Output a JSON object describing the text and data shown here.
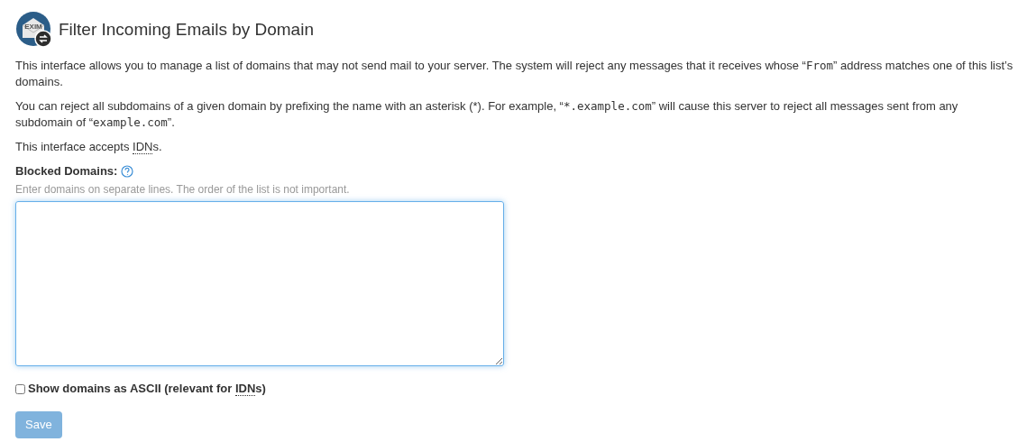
{
  "header": {
    "logo_text": "EXIM",
    "title": "Filter Incoming Emails by Domain"
  },
  "paragraphs": [
    [
      {
        "kind": "text",
        "text": "This interface allows you to manage a list of domains that may not send mail to your server. The system will reject any messages that it receives whose “"
      },
      {
        "kind": "code",
        "text": "From"
      },
      {
        "kind": "text",
        "text": "” address matches one of this list’s domains."
      }
    ],
    [
      {
        "kind": "text",
        "text": "You can reject all subdomains of a given domain by prefixing the name with an asterisk (*). For example, “"
      },
      {
        "kind": "code",
        "text": "*.example.com"
      },
      {
        "kind": "text",
        "text": "” will cause this server to reject all messages sent from any subdomain of “"
      },
      {
        "kind": "code",
        "text": "example.com"
      },
      {
        "kind": "text",
        "text": "”."
      }
    ],
    [
      {
        "kind": "text",
        "text": "This interface accepts "
      },
      {
        "kind": "abbr",
        "text": "IDN"
      },
      {
        "kind": "text",
        "text": "s."
      }
    ]
  ],
  "field": {
    "label": "Blocked Domains:",
    "help": "Enter domains on separate lines. The order of the list is not important.",
    "focused": true
  },
  "checkbox": {
    "checked": false,
    "label": [
      {
        "kind": "text",
        "text": "Show domains as ASCII (relevant for "
      },
      {
        "kind": "abbr",
        "text": "IDN"
      },
      {
        "kind": "text",
        "text": "s)"
      }
    ]
  },
  "save_button": {
    "label": "Save",
    "disabled": true
  }
}
